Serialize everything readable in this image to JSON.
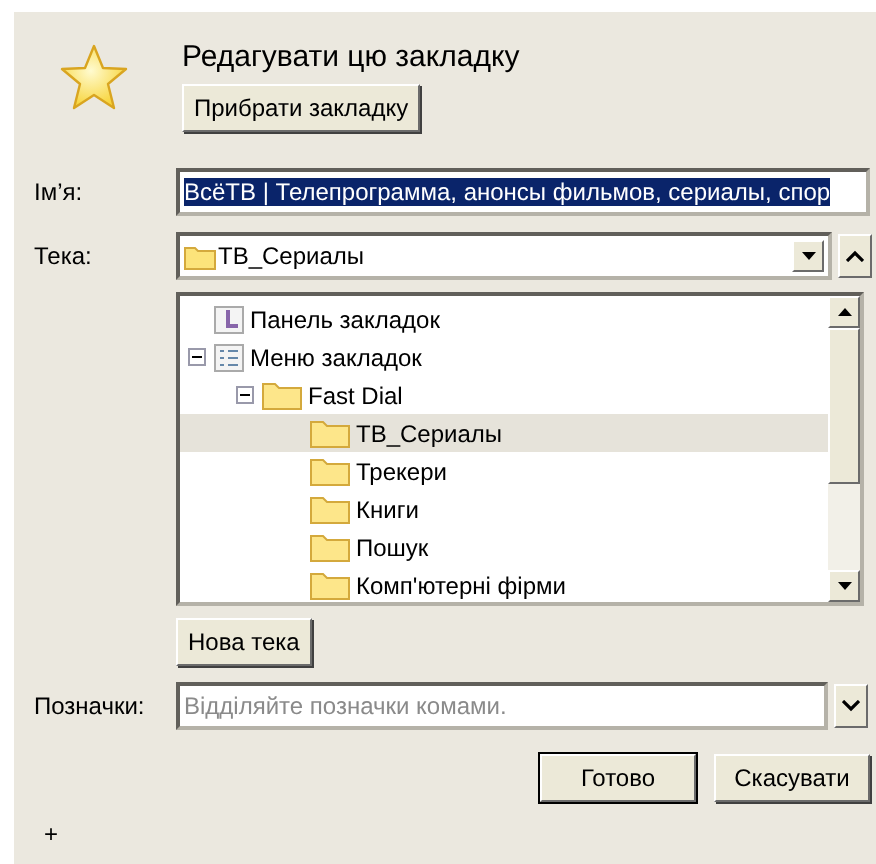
{
  "header": {
    "title": "Редагувати цю закладку",
    "remove_button": "Прибрати закладку"
  },
  "name_field": {
    "label": "Ім’я:",
    "value": "ВсёТВ | Телепрограмма, анонсы фильмов, сериалы, спор",
    "highlighted": true
  },
  "folder_field": {
    "label": "Тека:",
    "value": "ТВ_Сериалы"
  },
  "folder_tree": [
    {
      "label": "Панель закладок",
      "kind": "toolbar",
      "selected": false
    },
    {
      "label": "Меню закладок",
      "kind": "menu",
      "selected": false,
      "expanded": true,
      "children": [
        {
          "label": "Fast Dial",
          "kind": "folder",
          "selected": false,
          "expanded": true,
          "children": [
            {
              "label": "ТВ_Сериалы",
              "kind": "folder",
              "selected": true
            },
            {
              "label": "Трекери",
              "kind": "folder",
              "selected": false
            },
            {
              "label": "Книги",
              "kind": "folder",
              "selected": false
            },
            {
              "label": "Пошук",
              "kind": "folder",
              "selected": false
            },
            {
              "label": "Комп'ютерні фірми",
              "kind": "folder",
              "selected": false
            }
          ]
        }
      ]
    }
  ],
  "new_folder_button": "Нова тека",
  "tags_field": {
    "label": "Позначки:",
    "placeholder": "Відділяйте позначки комами."
  },
  "buttons": [
    {
      "label": "Готово",
      "default": true
    },
    {
      "label": "Скасувати",
      "default": false
    }
  ],
  "footer": "+"
}
